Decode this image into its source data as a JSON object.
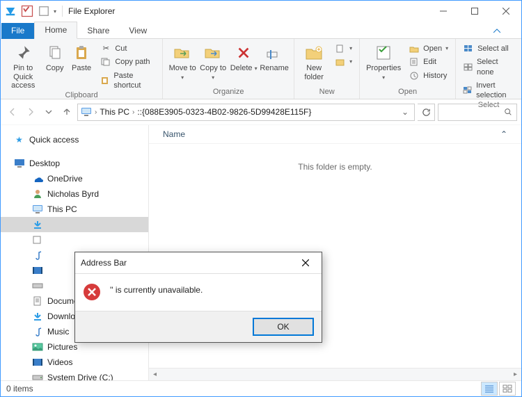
{
  "window": {
    "title": "File Explorer"
  },
  "tabs": {
    "file": "File",
    "home": "Home",
    "share": "Share",
    "view": "View"
  },
  "ribbon": {
    "groups": {
      "clipboard": "Clipboard",
      "organize": "Organize",
      "new": "New",
      "open": "Open",
      "select": "Select"
    },
    "pin": "Pin to Quick access",
    "copy": "Copy",
    "paste": "Paste",
    "cut": "Cut",
    "copy_path": "Copy path",
    "paste_shortcut": "Paste shortcut",
    "move_to": "Move to",
    "copy_to": "Copy to",
    "delete": "Delete",
    "rename": "Rename",
    "new_folder": "New folder",
    "properties": "Properties",
    "open": "Open",
    "edit": "Edit",
    "history": "History",
    "select_all": "Select all",
    "select_none": "Select none",
    "invert_selection": "Invert selection"
  },
  "breadcrumb": {
    "part1": "This PC",
    "part2": "::{088E3905-0323-4B02-9826-5D99428E115F}"
  },
  "nav": {
    "quick_access": "Quick access",
    "desktop": "Desktop",
    "onedrive": "OneDrive",
    "user": "Nicholas Byrd",
    "this_pc": "This PC",
    "documents": "Documents",
    "downloads": "Downloads",
    "music": "Music",
    "pictures": "Pictures",
    "videos": "Videos",
    "system_drive": "System Drive (C:)"
  },
  "content": {
    "col_name": "Name",
    "empty": "This folder is empty."
  },
  "status": {
    "items": "0 items"
  },
  "dialog": {
    "title": "Address Bar",
    "message": "'' is currently unavailable.",
    "ok": "OK"
  }
}
